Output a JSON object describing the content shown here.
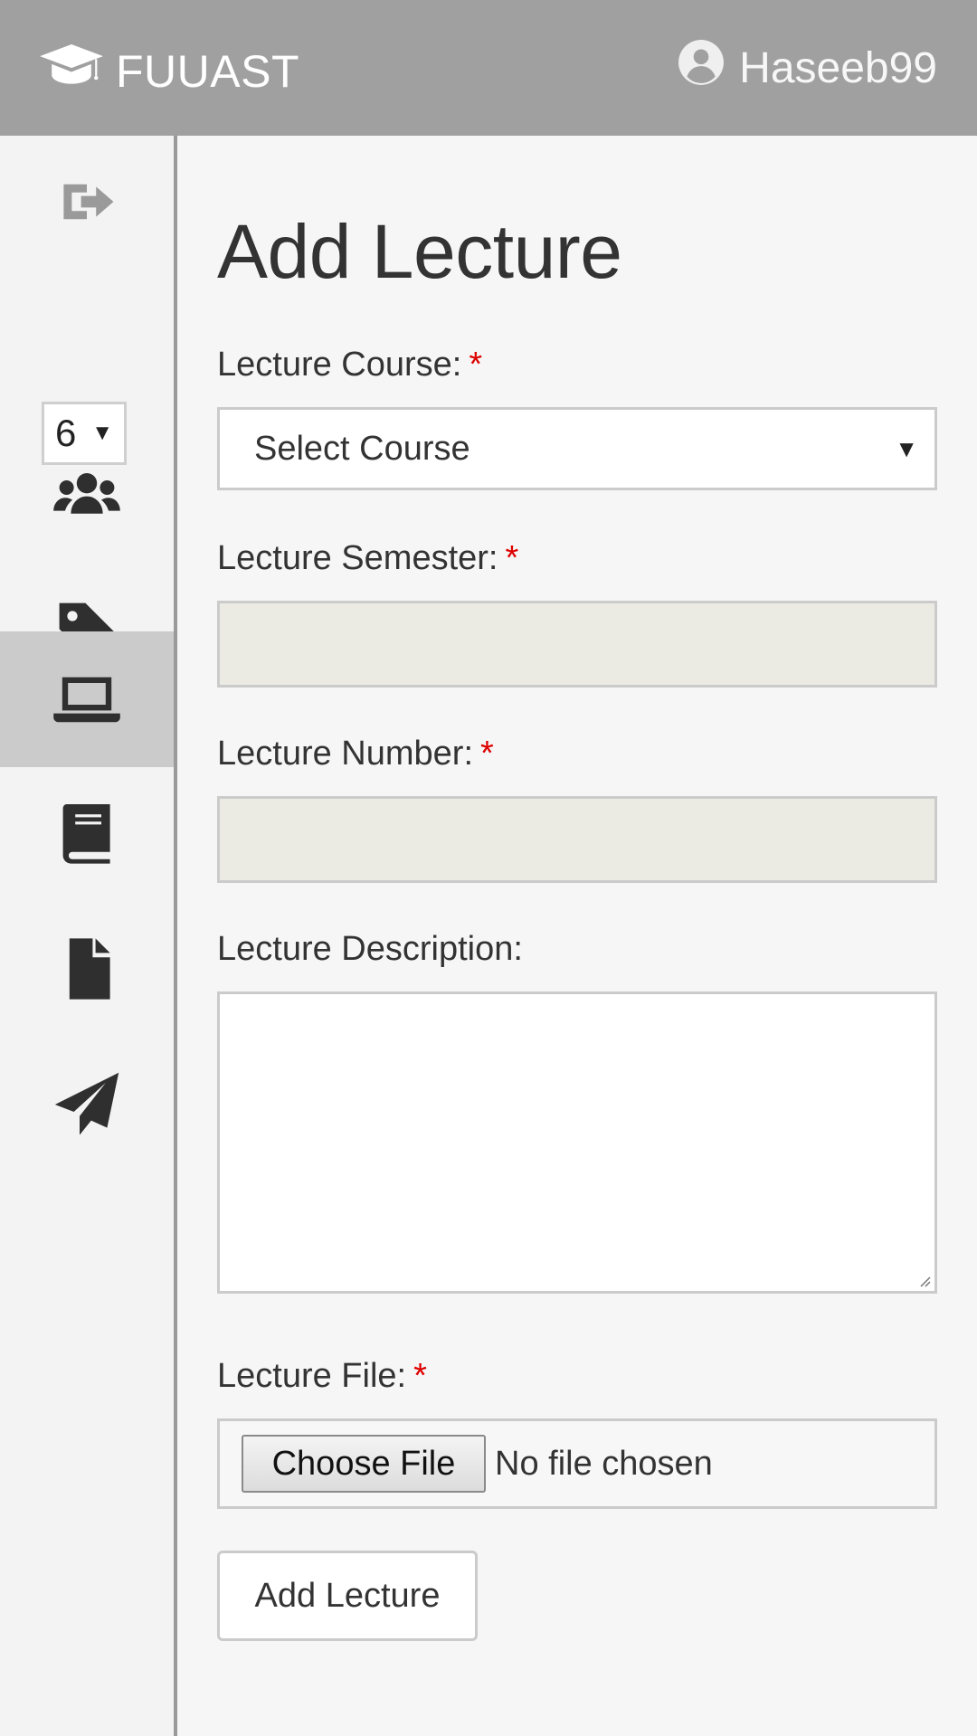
{
  "header": {
    "brand": "FUUAST",
    "username": "Haseeb99"
  },
  "sidebar": {
    "page_select": "6",
    "items": [
      {
        "name": "exit-icon"
      },
      {
        "name": "users-icon"
      },
      {
        "name": "tag-icon"
      },
      {
        "name": "laptop-icon",
        "active": true
      },
      {
        "name": "book-icon"
      },
      {
        "name": "file-icon"
      },
      {
        "name": "paper-plane-icon"
      }
    ]
  },
  "form": {
    "title": "Add Lecture",
    "course_label": "Lecture Course:",
    "course_value": "Select Course",
    "semester_label": "Lecture Semester:",
    "number_label": "Lecture Number:",
    "description_label": "Lecture Description:",
    "file_label": "Lecture File:",
    "file_button": "Choose File",
    "file_status": "No file chosen",
    "submit_label": "Add Lecture",
    "required_mark": "*",
    "required_color": "#dd0000"
  }
}
